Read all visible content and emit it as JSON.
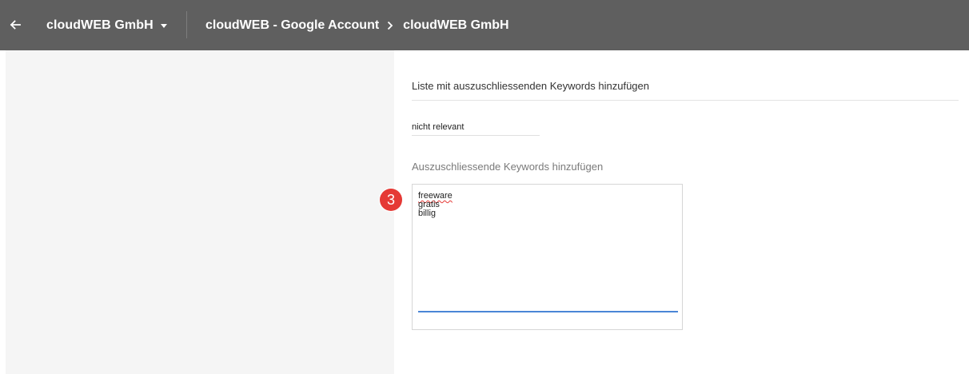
{
  "topbar": {
    "account_name": "cloudWEB GmbH",
    "breadcrumb": {
      "parent": "cloudWEB - Google Account",
      "separator": "›",
      "current": "cloudWEB GmbH"
    },
    "background_color": "#5f5f5f"
  },
  "form": {
    "section_title": "Liste mit auszuschliessenden Keywords hinzufügen",
    "list_name_value": "nicht relevant",
    "keywords_label": "Auszuschliessende Keywords hinzufügen",
    "keywords": [
      "freeware",
      "gratis",
      "billig"
    ],
    "focus_color": "#4a86d6"
  },
  "annotation": {
    "step_number": "3",
    "badge_color": "#e53935"
  }
}
